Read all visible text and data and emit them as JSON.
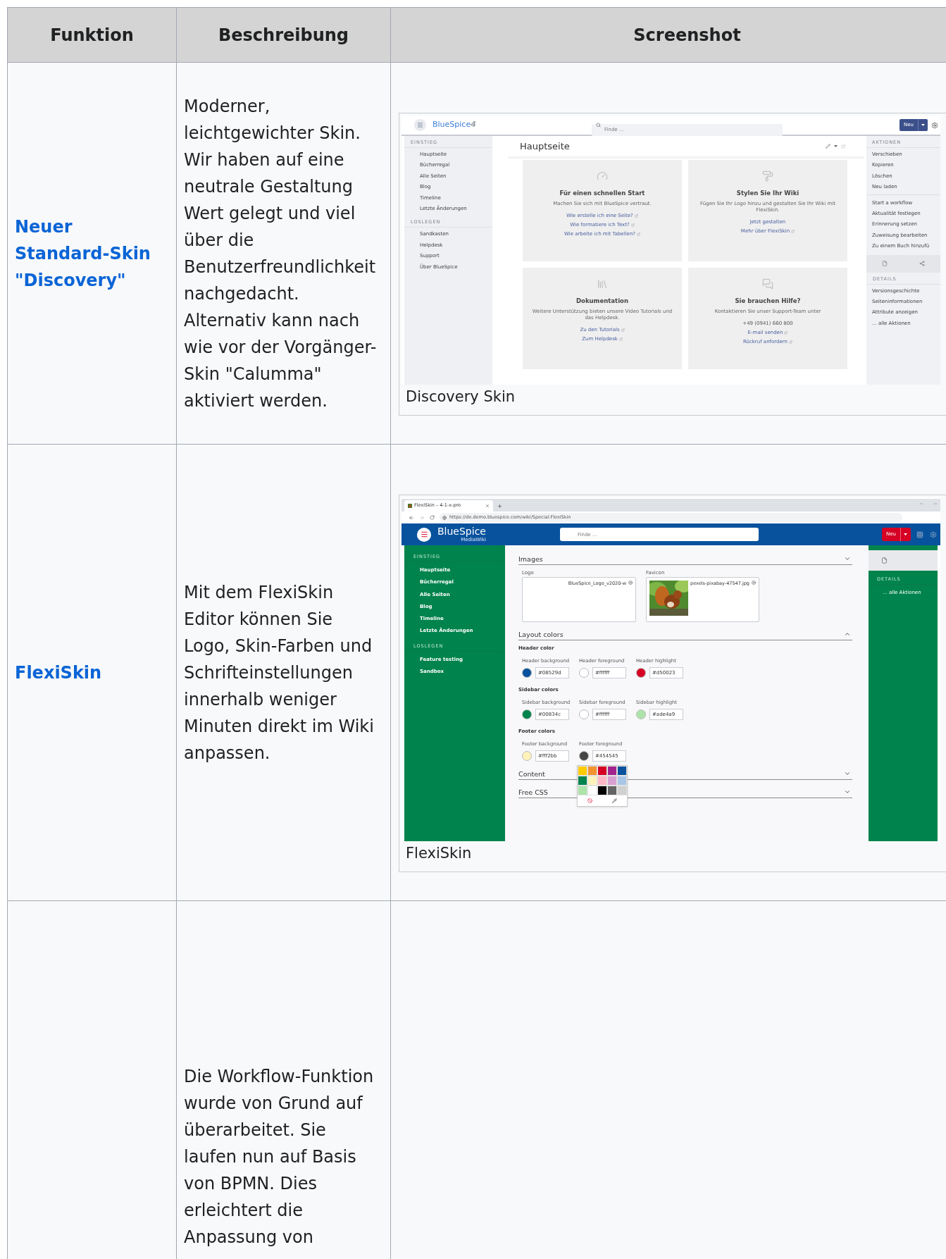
{
  "table": {
    "columns": [
      "Funktion",
      "Beschreibung",
      "Screenshot"
    ],
    "rows": [
      {
        "function": "Neuer Standard-Skin \"Discovery\"",
        "description": "Moderner, leichtgewichter Skin. Wir haben auf eine neutrale Gestaltung Wert gelegt und viel über die Benutzerfreundlichkeit nachgedacht. Alternativ kann nach wie vor der Vorgänger-Skin \"Calumma\" aktiviert werden.",
        "screenshot": {
          "kind": "discovery",
          "caption": "Discovery Skin",
          "logo": "BlueSpice",
          "logo_version": "4",
          "search_placeholder": "Finde ...",
          "new_button": "Neu",
          "page_title": "Hauptseite",
          "sidebar": [
            {
              "heading": "EINSTIEG",
              "items": [
                "Hauptseite",
                "Bücherregal",
                "Alle Seiten",
                "Blog",
                "Timeline",
                "Letzte Änderungen"
              ]
            },
            {
              "heading": "LOSLEGEN",
              "items": [
                "Sandkasten",
                "Helpdesk",
                "Support",
                "Über BlueSpice"
              ]
            }
          ],
          "cards": [
            {
              "title": "Für einen schnellen Start",
              "text": "Machen Sie sich mit BlueSpice vertraut.",
              "links": [
                {
                  "kind": "link",
                  "text": "Wie erstelle ich eine Seite?",
                  "external": true
                },
                {
                  "kind": "link",
                  "text": "Wie formatiere ich Text?",
                  "external": true
                },
                {
                  "kind": "link",
                  "text": "Wie arbeite ich mit Tabellen?",
                  "external": true
                }
              ]
            },
            {
              "title": "Stylen Sie Ihr Wiki",
              "text": "Fügen Sie Ihr Logo hinzu und gestalten Sie Ihr Wiki mit FlexiSkin.",
              "links": [
                {
                  "kind": "link",
                  "text": "Jetzt gestalten",
                  "external": false
                },
                {
                  "kind": "link",
                  "text": "Mehr über FlexiSkin",
                  "external": true
                }
              ]
            },
            {
              "title": "Dokumentation",
              "text": "Weitere Unterstützung bieten unsere Video Tutorials und das Helpdesk.",
              "links": [
                {
                  "kind": "link",
                  "text": "Zu den Tutorials",
                  "external": true
                },
                {
                  "kind": "link",
                  "text": "Zum Helpdesk",
                  "external": true
                }
              ]
            },
            {
              "title": "Sie brauchen Hilfe?",
              "text": "Kontaktieren Sie unser Support-Team unter",
              "links": [
                {
                  "kind": "text",
                  "text": "+49 (0941) 660 800",
                  "external": false
                },
                {
                  "kind": "link",
                  "text": "E-mail senden",
                  "external": true
                },
                {
                  "kind": "link",
                  "text": "Rückruf anfordern",
                  "external": true
                }
              ]
            }
          ],
          "actions": {
            "heading": "AKTIONEN",
            "groups": [
              [
                "Verschieben",
                "Kopieren",
                "Löschen",
                "Neu laden"
              ],
              [
                "Start a workflow",
                "Aktualität festlegen",
                "Erinnerung setzen",
                "Zuweisung bearbeiten",
                "Zu einem Buch hinzufü"
              ]
            ]
          },
          "details": {
            "heading": "DETAILS",
            "items": [
              "Versionsgeschichte",
              "Seiteninformationen",
              "Attribute anzeigen",
              "... alle Aktionen"
            ]
          }
        }
      },
      {
        "function": "FlexiSkin",
        "description": "Mit dem FlexiSkin Editor können Sie Logo, Skin-Farben und Schrifteinstellungen innerhalb weniger Minuten direkt im Wiki anpassen.",
        "screenshot": {
          "kind": "flexiskin",
          "caption": "FlexiSkin",
          "tab_title": "FlexiSkin – 4-1-x-pro",
          "url": "https://de.demo.bluespice.com/wiki/Special:FlexiSkin",
          "logo": "BlueSpice",
          "logo_sub": "MediaWiki",
          "search_placeholder": "Finde ...",
          "new_button": "Neu",
          "sidebar": [
            {
              "heading": "EINSTIEG",
              "items": [
                "Hauptseite",
                "Bücherregal",
                "Alle Seiten",
                "Blog",
                "Timeline",
                "Letzte Änderungen"
              ]
            },
            {
              "heading": "LOSLEGEN",
              "items": [
                "Feature testing",
                "Sandbox"
              ]
            }
          ],
          "details": {
            "heading": "DETAILS",
            "items": [
              "... alle Aktionen"
            ]
          },
          "sections": [
            {
              "kind": "images",
              "title": "Images",
              "chevron_up": false,
              "images": [
                {
                  "label": "Logo",
                  "file": "BlueSpice_Logo_v2020-w",
                  "picture": false
                },
                {
                  "label": "Favicon",
                  "file": "pexels-pixabay-47547.jpg",
                  "picture": true
                }
              ]
            },
            {
              "kind": "colors",
              "title": "Layout colors",
              "chevron_up": true,
              "groups": [
                {
                  "title": "Header color",
                  "fields": [
                    {
                      "label": "Header background",
                      "value": "#08529d",
                      "color": "#08529d"
                    },
                    {
                      "label": "Header foreground",
                      "value": "#ffffff",
                      "color": "#ffffff"
                    },
                    {
                      "label": "Header highlight",
                      "value": "#d50023",
                      "color": "#d50023"
                    }
                  ]
                },
                {
                  "title": "Sidebar colors",
                  "fields": [
                    {
                      "label": "Sidebar background",
                      "value": "#00834c",
                      "color": "#00834c"
                    },
                    {
                      "label": "Sidebar foreground",
                      "value": "#ffffff",
                      "color": "#ffffff"
                    },
                    {
                      "label": "Sidebar highlight",
                      "value": "#ade4a9",
                      "color": "#ade4a9"
                    }
                  ]
                },
                {
                  "title": "Footer colors",
                  "fields": [
                    {
                      "label": "Footer background",
                      "value": "#fff2bb",
                      "color": "#fff2bb"
                    },
                    {
                      "label": "Footer foreground",
                      "value": "#454545",
                      "color": "#454545"
                    }
                  ]
                }
              ]
            },
            {
              "kind": "collapsed",
              "title": "Content",
              "chevron_up": false
            },
            {
              "kind": "collapsed",
              "title": "Free CSS",
              "chevron_up": false
            }
          ],
          "color_picker": {
            "colors": [
              {
                "color": "#ffcc00"
              },
              {
                "color": "#f39330"
              },
              {
                "color": "#d50023"
              },
              {
                "color": "#a3238e"
              },
              {
                "color": "#08529d"
              },
              {
                "color": "#00834c"
              },
              {
                "color": "#fff2bb"
              },
              {
                "color": "#ffb7c5"
              },
              {
                "color": "#d8a0d2"
              },
              {
                "color": "#a8c6e8"
              },
              {
                "color": "#ade4a9"
              },
              {
                "color": "#ffffff"
              },
              {
                "color": "#000000"
              },
              {
                "color": "#646464"
              },
              {
                "color": "#d0d0d0"
              }
            ]
          }
        }
      },
      {
        "description": "Die Workflow-Funktion wurde von Grund auf überarbeitet. Sie laufen nun auf Basis von BPMN. Dies erleichtert die Anpassung von"
      }
    ]
  }
}
